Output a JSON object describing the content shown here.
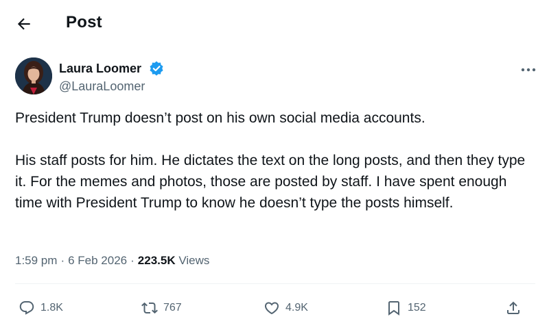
{
  "header": {
    "title": "Post",
    "back_icon": "arrow-left-icon"
  },
  "author": {
    "name": "Laura Loomer",
    "handle": "@LauraLoomer",
    "verified_color": "#1d9bf0",
    "more_icon": "more-horizontal-icon"
  },
  "post": {
    "paragraphs": [
      "President Trump doesn’t post on his own social media accounts.",
      "His staff posts for him. He dictates the text on the long posts, and then they type it. For the memes and photos, those are posted by staff. I have spent enough time with President Trump to know he doesn’t type the posts himself."
    ]
  },
  "meta": {
    "time": "1:59 pm",
    "date": "6 Feb 2026",
    "views_count": "223.5K",
    "views_label": "Views"
  },
  "actions": {
    "reply": {
      "count": "1.8K",
      "icon": "reply-icon"
    },
    "repost": {
      "count": "767",
      "icon": "repost-icon"
    },
    "like": {
      "count": "4.9K",
      "icon": "heart-icon"
    },
    "bookmark": {
      "count": "152",
      "icon": "bookmark-icon"
    },
    "share": {
      "icon": "share-icon"
    }
  },
  "colors": {
    "text": "#0f1419",
    "secondary": "#536471",
    "divider": "#eff3f4",
    "accent": "#1d9bf0"
  }
}
